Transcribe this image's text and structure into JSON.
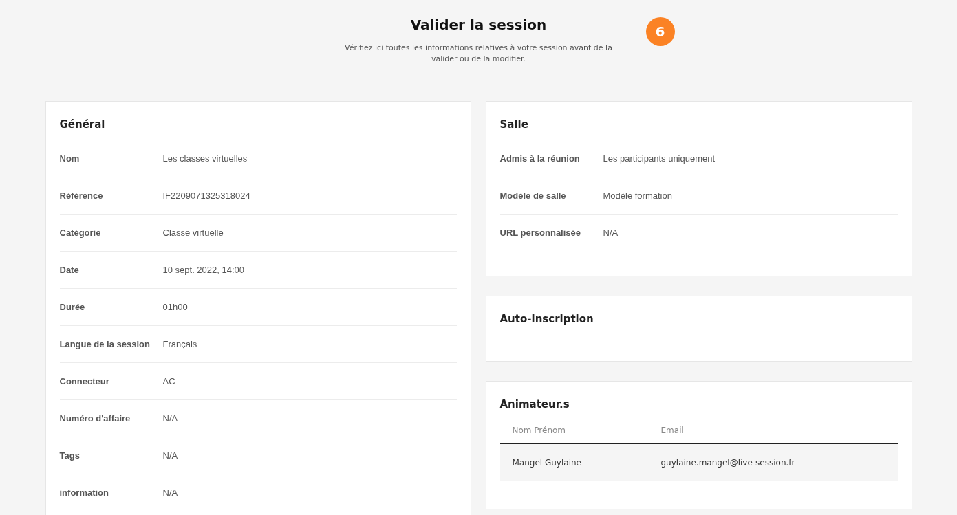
{
  "header": {
    "title": "Valider la session",
    "subtitle": "Vérifiez ici toutes les informations relatives à votre session avant de la valider ou de la modifier.",
    "step": "6"
  },
  "general": {
    "title": "Général",
    "rows": [
      {
        "label": "Nom",
        "value": "Les classes virtuelles"
      },
      {
        "label": "Référence",
        "value": "IF2209071325318024"
      },
      {
        "label": "Catégorie",
        "value": "Classe virtuelle"
      },
      {
        "label": "Date",
        "value": "10 sept. 2022, 14:00"
      },
      {
        "label": "Durée",
        "value": "01h00"
      },
      {
        "label": "Langue de la session",
        "value": "Français"
      },
      {
        "label": "Connecteur",
        "value": "AC"
      },
      {
        "label": "Numéro d'affaire",
        "value": "N/A"
      },
      {
        "label": "Tags",
        "value": "N/A"
      },
      {
        "label": "information",
        "value": "N/A"
      }
    ]
  },
  "salle": {
    "title": "Salle",
    "rows": [
      {
        "label": "Admis à la réunion",
        "value": "Les participants uniquement"
      },
      {
        "label": "Modèle de salle",
        "value": "Modèle formation"
      },
      {
        "label": "URL personnalisée",
        "value": "N/A"
      }
    ]
  },
  "auto_inscription": {
    "title": "Auto-inscription"
  },
  "animateurs": {
    "title": "Animateur.s",
    "table": {
      "columns": [
        "Nom Prénom",
        "Email"
      ],
      "rows": [
        [
          "Mangel Guylaine",
          "guylaine.mangel@live-session.fr"
        ]
      ]
    }
  }
}
